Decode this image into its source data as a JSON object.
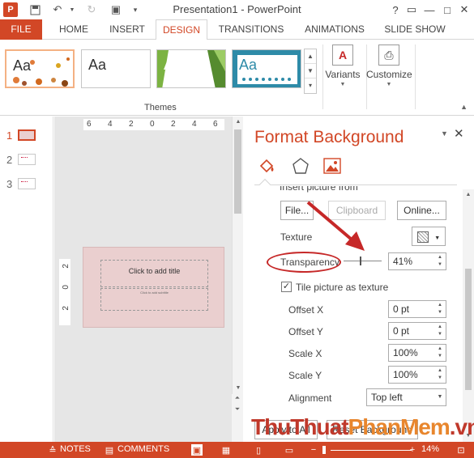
{
  "window": {
    "title": "Presentation1 - PowerPoint",
    "app_logo": "P",
    "controls": [
      "?",
      "▭",
      "—",
      "□",
      "✕"
    ]
  },
  "ribbon": {
    "tabs": [
      "FILE",
      "HOME",
      "INSERT",
      "DESIGN",
      "TRANSITIONS",
      "ANIMATIONS",
      "SLIDE SHOW"
    ],
    "active_tab": "DESIGN",
    "theme_sample": "Aa",
    "themes_label": "Themes",
    "variants_label": "Variants",
    "customize_label": "Customize"
  },
  "thumbnails": [
    "1",
    "2",
    "3"
  ],
  "editor": {
    "ruler_h": [
      "6",
      "4",
      "2",
      "0",
      "2",
      "4",
      "6"
    ],
    "ruler_v": [
      "2",
      "0",
      "2"
    ],
    "title_placeholder": "Click to add title",
    "subtitle_placeholder": "Click to add subtitle"
  },
  "pane": {
    "title": "Format Background",
    "cut_label": "Insert picture from",
    "file_button": "File...",
    "clipboard_button": "Clipboard",
    "online_button": "Online...",
    "texture_label": "Texture",
    "transparency_label": "Transparency",
    "transparency_value": "41%",
    "tile_label": "Tile picture as texture",
    "offset_x_label": "Offset X",
    "offset_x_value": "0 pt",
    "offset_y_label": "Offset Y",
    "offset_y_value": "0 pt",
    "scale_x_label": "Scale X",
    "scale_x_value": "100%",
    "scale_y_label": "Scale Y",
    "scale_y_value": "100%",
    "alignment_label": "Alignment",
    "alignment_value": "Top left",
    "apply_all_button": "Apply to All",
    "reset_button": "Reset Background"
  },
  "status": {
    "notes": "NOTES",
    "comments": "COMMENTS",
    "zoom": "14%"
  },
  "watermark": {
    "part1": "ThuThuat",
    "part2": "PhanMem",
    "part3": ".vn"
  },
  "colors": {
    "accent": "#d24726",
    "annotation": "#c62828"
  }
}
